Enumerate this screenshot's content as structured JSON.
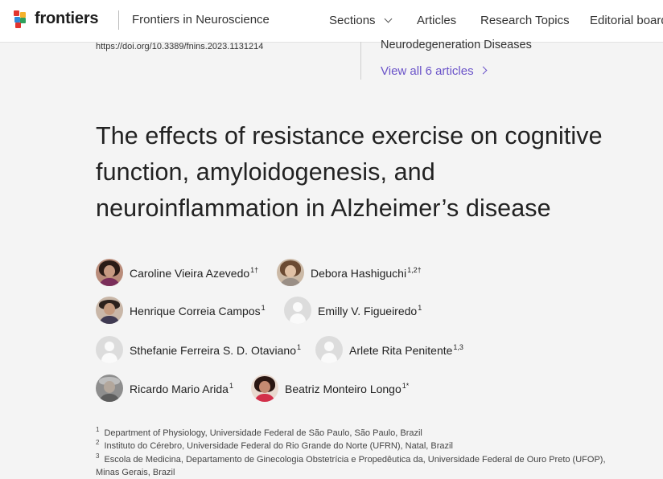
{
  "header": {
    "brand": "frontiers",
    "journal": "Frontiers in Neuroscience",
    "nav": [
      {
        "label": "Sections"
      },
      {
        "label": "Articles"
      },
      {
        "label": "Research Topics"
      },
      {
        "label": "Editorial board"
      }
    ]
  },
  "article": {
    "doi": "https://doi.org/10.3389/fnins.2023.1131214",
    "title": "The effects of resistance exercise on cognitive function, amyloidogenesis, and neuroinflammation in Alzheimer’s disease"
  },
  "research_topic": {
    "name": "Neurodegeneration Diseases",
    "view_all": "View all 6 articles"
  },
  "authors": [
    {
      "name": "Caroline Vieira Azevedo",
      "sup": "1†",
      "photo": "hair-dark"
    },
    {
      "name": "Debora Hashiguchi",
      "sup": "1,2†",
      "photo": "hair-brown"
    },
    {
      "name": "Henrique Correia Campos",
      "sup": "1",
      "photo": "short-dark"
    },
    {
      "name": "Emilly V. Figueiredo",
      "sup": "1",
      "photo": "placeholder"
    },
    {
      "name": "Sthefanie Ferreira S. D. Otaviano",
      "sup": "1",
      "photo": "placeholder"
    },
    {
      "name": "Arlete Rita Penitente",
      "sup": "1,3",
      "photo": "placeholder"
    },
    {
      "name": "Ricardo Mario Arida",
      "sup": "1",
      "photo": "grey"
    },
    {
      "name": "Beatriz Monteiro Longo",
      "sup": "1*",
      "photo": "hair-dark-red"
    }
  ],
  "affiliations": [
    {
      "num": "1",
      "text": "Department of Physiology, Universidade Federal de São Paulo, São Paulo, Brazil"
    },
    {
      "num": "2",
      "text": "Instituto do Cérebro, Universidade Federal do Rio Grande do Norte (UFRN), Natal, Brazil"
    },
    {
      "num": "3",
      "text": "Escola de Medicina, Departamento de Ginecologia Obstetrícia e Propedêutica da, Universidade Federal de Ouro Preto (UFOP), Minas Gerais, Brazil"
    }
  ],
  "colors": {
    "link": "#6b54c9",
    "header_bg": "#ffffff",
    "page_bg": "#f4f4f4"
  }
}
